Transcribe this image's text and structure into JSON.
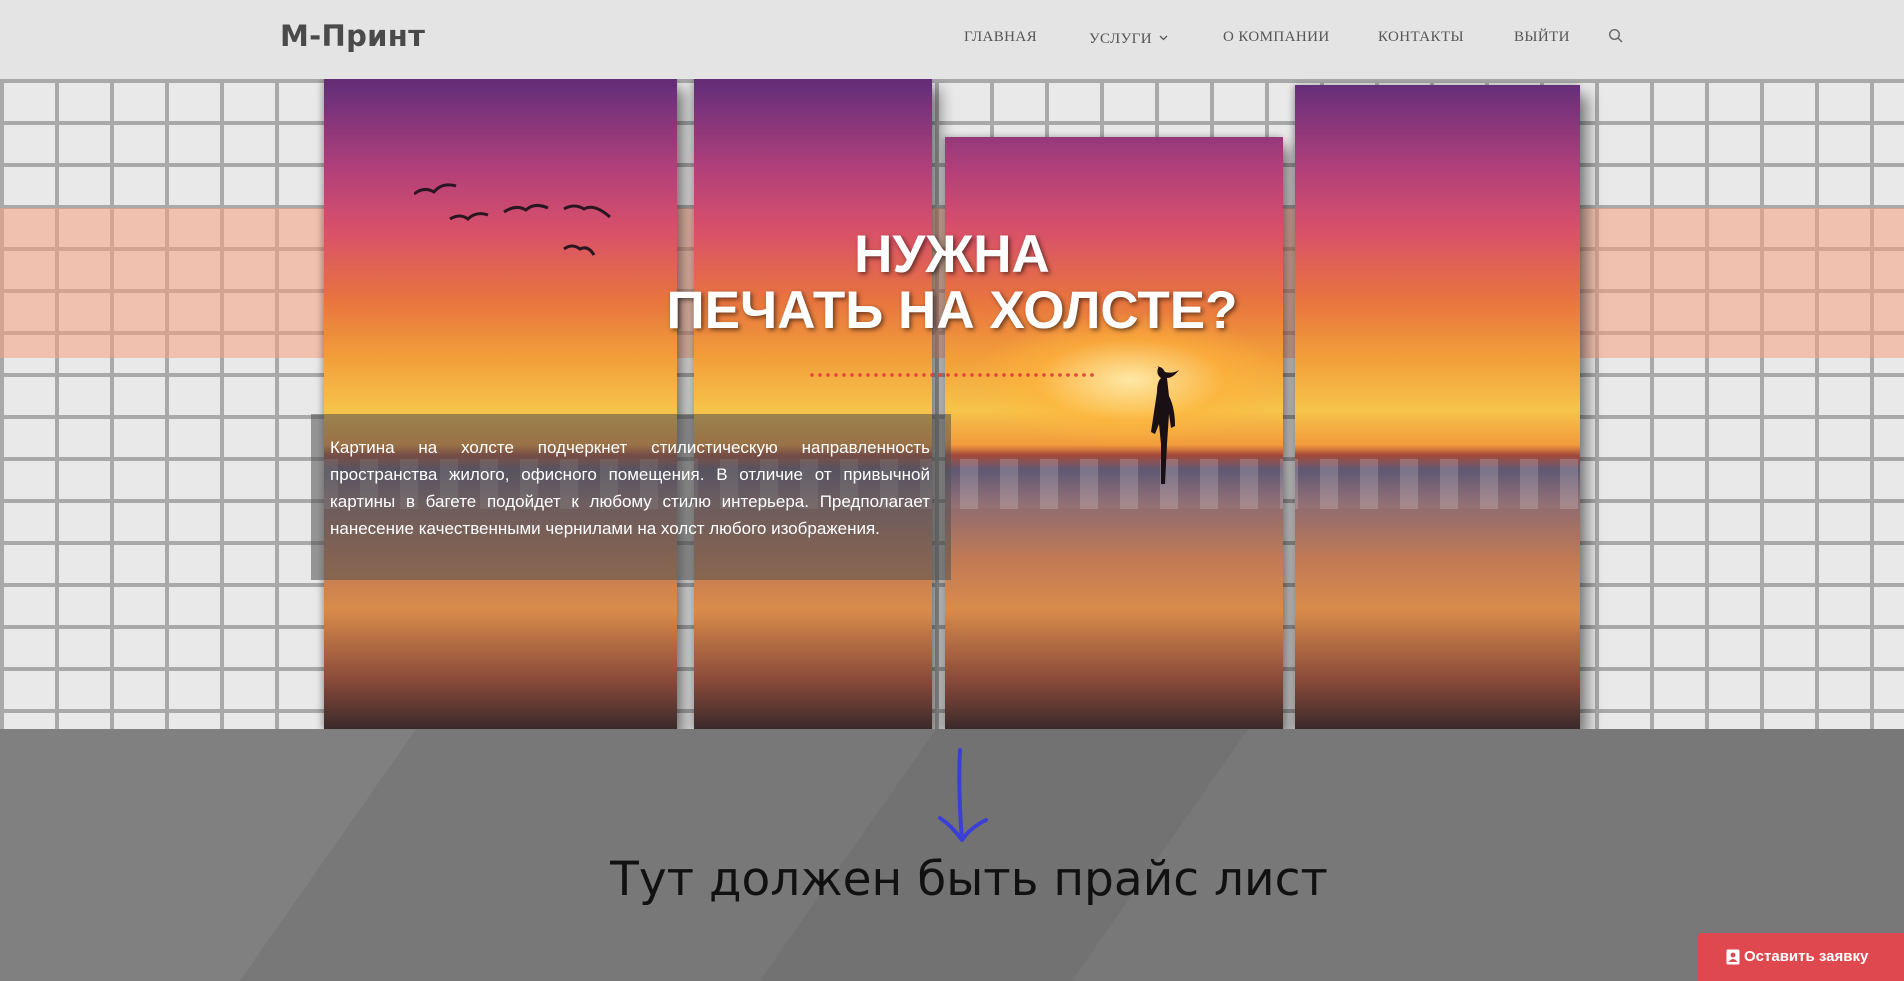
{
  "header": {
    "logo": "М-Принт",
    "nav": [
      {
        "label": "ГЛАВНАЯ"
      },
      {
        "label": "УСЛУГИ"
      },
      {
        "label": "О КОМПАНИИ"
      },
      {
        "label": "КОНТАКТЫ"
      },
      {
        "label": "ВЫЙТИ"
      }
    ],
    "icons": {
      "dropdown": "chevron-down-icon",
      "search": "search-icon"
    }
  },
  "hero": {
    "title_line1": "НУЖНА",
    "title_line2": "ПЕЧАТЬ НА ХОЛСТЕ?",
    "description": "Картина на холсте подчеркнет стилистическую направленность пространства жилого, офисного помещения. В отличие от привычной картины в багете подойдет к любому стилю интерьера. Предполагает нанесение качественными чернилами на холст любого изображения."
  },
  "price_section": {
    "note": "Тут должен быть прайс лист",
    "arrow_color": "#3a3fd6"
  },
  "cta": {
    "label": "Оставить заявку",
    "icon": "contact-card-icon",
    "color": "#e0484f"
  },
  "colors": {
    "header_bg": "#e4e4e4",
    "accent_red": "#e0453a",
    "bottom_bg": "#787878"
  }
}
